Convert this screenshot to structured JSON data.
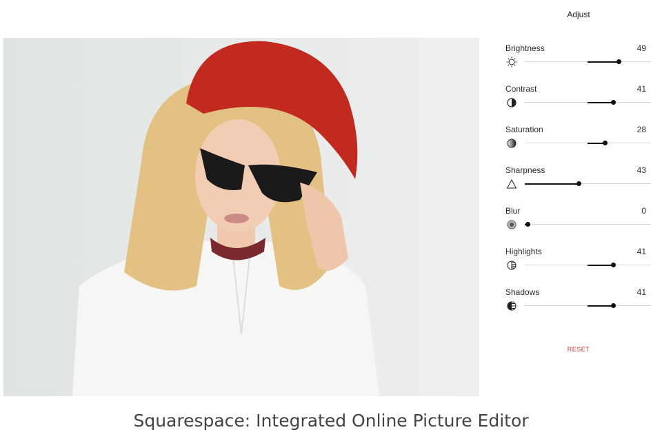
{
  "panel": {
    "title": "Adjust",
    "adjustments": [
      {
        "label": "Brightness",
        "value": "49",
        "level": 0.49,
        "icon": "brightness-icon"
      },
      {
        "label": "Contrast",
        "value": "41",
        "level": 0.41,
        "icon": "contrast-icon"
      },
      {
        "label": "Saturation",
        "value": "28",
        "level": 0.28,
        "icon": "saturation-icon"
      },
      {
        "label": "Sharpness",
        "value": "43",
        "level": 0.43,
        "icon": "sharpness-icon"
      },
      {
        "label": "Blur",
        "value": "0",
        "level": 0,
        "icon": "blur-icon"
      },
      {
        "label": "Highlights",
        "value": "41",
        "level": 0.41,
        "icon": "highlights-icon"
      },
      {
        "label": "Shadows",
        "value": "41",
        "level": 0.41,
        "icon": "shadows-icon"
      }
    ],
    "reset_label": "RESET"
  },
  "caption": "Squarespace: Integrated Online Picture Editor",
  "colors": {
    "accent_reset": "#d0322d",
    "slider_fill": "#111111",
    "slider_track": "#d9d9d9"
  }
}
